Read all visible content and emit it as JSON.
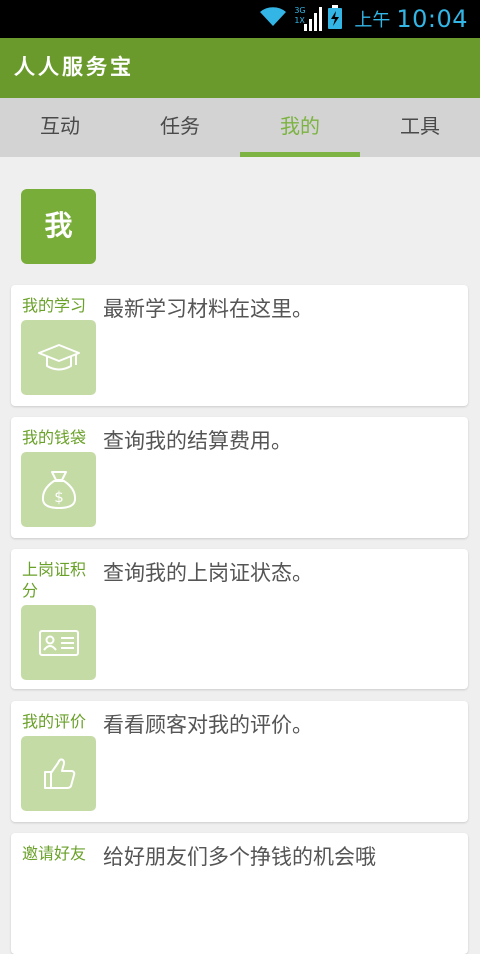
{
  "status_bar": {
    "network": "3G",
    "network_sub": "1X",
    "ampm": "上午",
    "time": "10:04",
    "accent": "#33b5e5"
  },
  "app": {
    "title": "人人服务宝",
    "brand_color": "#6b9a2c"
  },
  "tabs": [
    {
      "label": "互动",
      "active": false
    },
    {
      "label": "任务",
      "active": false
    },
    {
      "label": "我的",
      "active": true
    },
    {
      "label": "工具",
      "active": false
    }
  ],
  "profile": {
    "avatar_text": "我"
  },
  "cards": [
    {
      "label": "我的学习",
      "icon": "graduation-cap-icon",
      "desc": "最新学习材料在这里。"
    },
    {
      "label": "我的钱袋",
      "icon": "money-bag-icon",
      "desc": "查询我的结算费用。"
    },
    {
      "label": "上岗证积分",
      "icon": "id-card-icon",
      "desc": "查询我的上岗证状态。"
    },
    {
      "label": "我的评价",
      "icon": "thumbs-up-icon",
      "desc": "看看顾客对我的评价。"
    },
    {
      "label": "邀请好友",
      "icon": "",
      "desc": "给好朋友们多个挣钱的机会哦"
    }
  ]
}
